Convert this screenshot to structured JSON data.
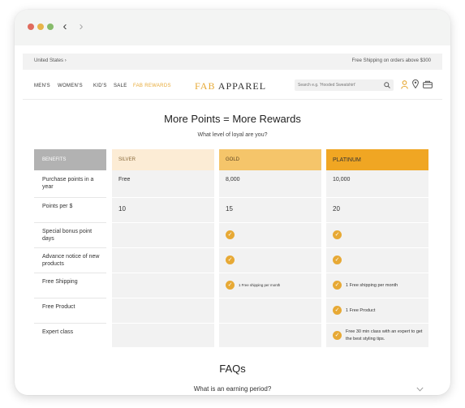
{
  "browser": {
    "back_icon": "chevron-left-icon",
    "forward_icon": "chevron-right-icon"
  },
  "topbar": {
    "country": "United States",
    "shipping_notice": "Free Shipping on orders above $300"
  },
  "nav": {
    "links": [
      "MEN'S",
      "WOMEN'S",
      "KID'S",
      "SALE",
      "FAB REWARDS"
    ],
    "active_index": 4,
    "logo": "FAB APPAREL",
    "search_placeholder": "Search e.g. 'Hooded Sweatshirt'",
    "icons": [
      "search-icon",
      "user-icon",
      "location-pin-icon",
      "cart-icon"
    ]
  },
  "rewards": {
    "heading": "More Points = More Rewards",
    "subheading": "What level of loyal are you?",
    "columns": [
      "BENEFITS",
      "SILVER",
      "GOLD",
      "PLATINUM"
    ],
    "rows": [
      {
        "label": "Purchase points in a year",
        "silver": "Free",
        "gold": "8,000",
        "platinum": "10,000"
      },
      {
        "label": "Points per $",
        "silver": "10",
        "gold": "15",
        "platinum": "20"
      },
      {
        "label": "Special bonus point days",
        "silver": "",
        "gold": "check",
        "platinum": "check"
      },
      {
        "label": "Advance notice of new products",
        "silver": "",
        "gold": "check",
        "platinum": "check"
      },
      {
        "label": "Free Shipping",
        "silver": "",
        "gold": "1 Free shipping per month",
        "platinum": "1 Free shipping per month"
      },
      {
        "label": "Free Product",
        "silver": "",
        "gold": "",
        "platinum": "1 Free Product"
      },
      {
        "label": "Expert class",
        "silver": "",
        "gold": "",
        "platinum": "Free 30 min class with an expert to get the best styling tips."
      }
    ],
    "colors": {
      "benefits_header": "#b2b2b2",
      "silver_header": "#fcecd5",
      "gold_header": "#f5c56a",
      "platinum_header": "#f0a623",
      "check": "#e7a935"
    }
  },
  "faq": {
    "heading": "FAQs",
    "question": "What is an earning period?"
  }
}
